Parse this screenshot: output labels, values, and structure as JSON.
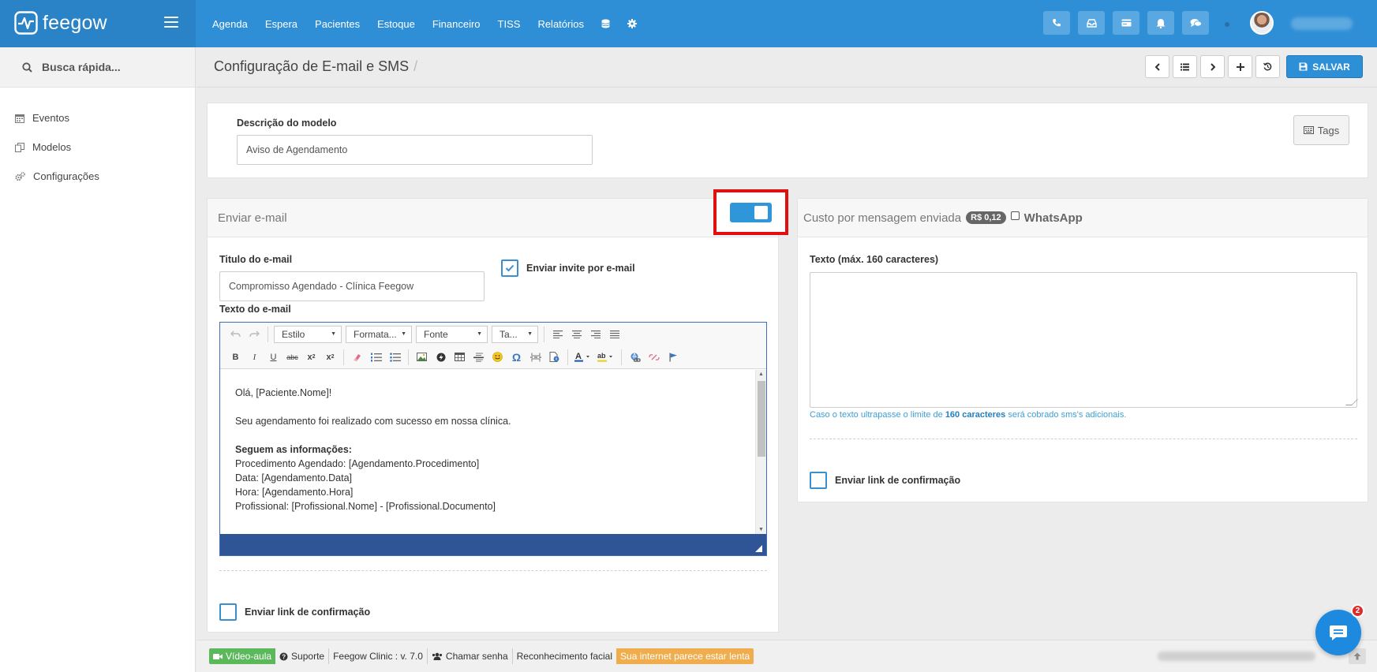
{
  "brand": {
    "name": "feegow"
  },
  "nav": {
    "items": [
      "Agenda",
      "Espera",
      "Pacientes",
      "Estoque",
      "Financeiro",
      "TISS",
      "Relatórios"
    ],
    "extra_icons": [
      "database-icon",
      "gear-icon"
    ]
  },
  "top_actions": [
    "phone-icon",
    "inbox-icon",
    "card-icon",
    "bell-icon",
    "chat-icon"
  ],
  "sidebar": {
    "search_label": "Busca rápida...",
    "items": [
      {
        "label": "Eventos",
        "icon": "calendar-icon"
      },
      {
        "label": "Modelos",
        "icon": "copy-icon"
      },
      {
        "label": "Configurações",
        "icon": "gears-icon"
      }
    ]
  },
  "page": {
    "title": "Configuração de E-mail e SMS",
    "save_label": "SALVAR"
  },
  "description": {
    "label": "Descrição do modelo",
    "value": "Aviso de Agendamento",
    "tags_label": "Tags"
  },
  "email": {
    "header": "Enviar e-mail",
    "toggle_on": true,
    "title_label": "Titulo do e-mail",
    "title_value": "Compromisso Agendado - Clínica Feegow",
    "invite_label": "Enviar invite por e-mail",
    "invite_checked": true,
    "text_label": "Texto do e-mail",
    "toolbar": {
      "style": "Estilo",
      "format": "Formata...",
      "font": "Fonte",
      "size": "Ta..."
    },
    "body": {
      "greeting": "Olá, [Paciente.Nome]!",
      "line1": "Seu agendamento foi realizado com sucesso em nossa clínica.",
      "heading": "Seguem as informações:",
      "line_proc": "Procedimento Agendado: [Agendamento.Procedimento]",
      "line_date": "Data: [Agendamento.Data]",
      "line_time": "Hora: [Agendamento.Hora]",
      "line_prof": "Profissional: [Profissional.Nome] - [Profissional.Documento]"
    },
    "confirm_label": "Enviar link de confirmação"
  },
  "sms": {
    "header": "Custo por mensagem enviada",
    "price": "R$ 0,12",
    "whatsapp_label": "WhatsApp",
    "text_label": "Texto (máx. 160 caracteres)",
    "note_prefix": "Caso o texto ultrapasse o limite de ",
    "note_bold": "160 caracteres",
    "note_suffix": " será cobrado sms's adicionais.",
    "confirm_label": "Enviar link de confirmação"
  },
  "footer": {
    "video": "Vídeo-aula",
    "support": "Suporte",
    "version": "Feegow Clinic : v. 7.0",
    "call_password": "Chamar senha",
    "face_recognition": "Reconhecimento facial",
    "warning": "Sua internet parece estar lenta"
  },
  "chat": {
    "badge": "2"
  }
}
